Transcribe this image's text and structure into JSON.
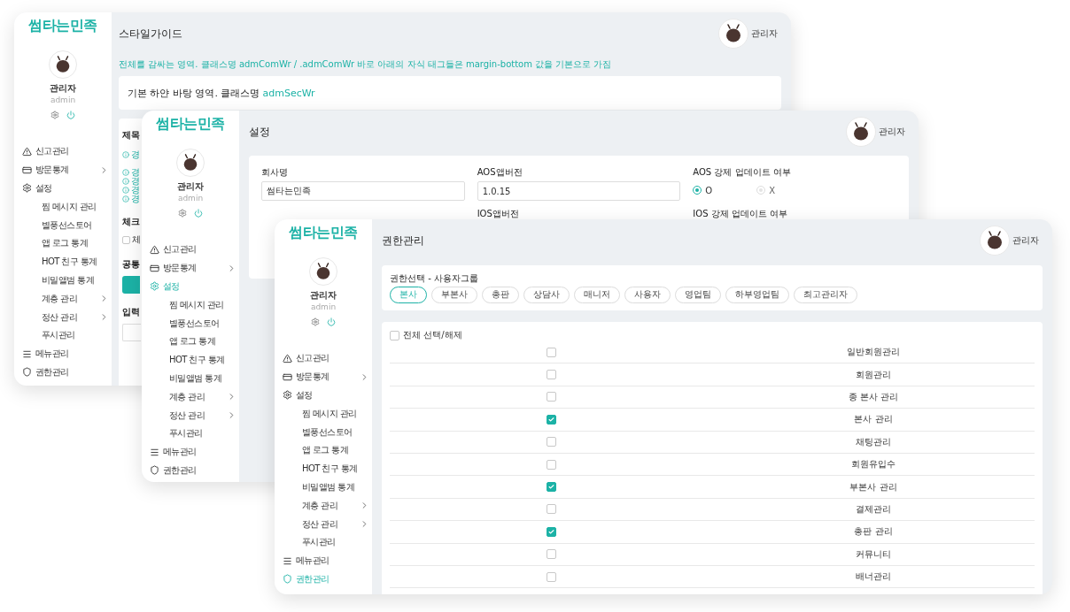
{
  "windows": [
    {
      "kind": "styleguide",
      "sidebar": {
        "logo": "썸타는민족",
        "profile": {
          "name": "관리자",
          "role": "admin"
        },
        "menu": [
          {
            "label": "신고관리",
            "kind": "main",
            "has_submenu": false,
            "selected": false
          },
          {
            "label": "방문통계",
            "kind": "main",
            "has_submenu": true,
            "selected": false
          },
          {
            "label": "설정",
            "kind": "main",
            "has_submenu": false,
            "selected": false
          },
          {
            "label": "찜 메시지 관리",
            "kind": "sub",
            "has_submenu": false,
            "selected": false
          },
          {
            "label": "별풍선스토어",
            "kind": "sub",
            "has_submenu": false,
            "selected": false
          },
          {
            "label": "앱 로그 통계",
            "kind": "sub",
            "has_submenu": false,
            "selected": false
          },
          {
            "label": "HOT 친구 통계",
            "kind": "sub",
            "has_submenu": false,
            "selected": false
          },
          {
            "label": "비밀앨범 통계",
            "kind": "sub",
            "has_submenu": false,
            "selected": false
          },
          {
            "label": "계층 관리",
            "kind": "sub",
            "has_submenu": true,
            "selected": false
          },
          {
            "label": "정산 관리",
            "kind": "sub",
            "has_submenu": true,
            "selected": false
          },
          {
            "label": "푸시관리",
            "kind": "sub",
            "has_submenu": false,
            "selected": false
          },
          {
            "label": "메뉴관리",
            "kind": "main",
            "has_submenu": false,
            "selected": false
          },
          {
            "label": "권한관리",
            "kind": "main",
            "has_submenu": false,
            "selected": false
          }
        ]
      },
      "header": {
        "title": "스타일가이드",
        "user": "관리자"
      },
      "note": "전체를 감싸는 영역. 클래스명 admComWr / .admComWr 바로 아래의 자식 태그들은 margin-bottom 값을 기본으로 가짐",
      "white_card": {
        "text": "기본 하얀 바탕 영역. 클래스명",
        "class_name": "admSecWr"
      },
      "sections": [
        {
          "title": "제목",
          "warning_groups": [
            [
              "경"
            ],
            [
              "경",
              "경",
              "경",
              "경"
            ]
          ]
        },
        {
          "title": "체크",
          "checkbox": {
            "label": "체",
            "checked": false
          }
        },
        {
          "title": "공통",
          "button": true
        },
        {
          "title": "입력",
          "input": true
        }
      ]
    },
    {
      "kind": "settings",
      "sidebar": {
        "logo": "썸타는민족",
        "profile": {
          "name": "관리자",
          "role": "admin"
        },
        "menu": [
          {
            "label": "신고관리",
            "kind": "main",
            "has_submenu": false,
            "selected": false
          },
          {
            "label": "방문통계",
            "kind": "main",
            "has_submenu": true,
            "selected": false
          },
          {
            "label": "설정",
            "kind": "main",
            "has_submenu": false,
            "selected": true
          },
          {
            "label": "찜 메시지 관리",
            "kind": "sub",
            "has_submenu": false,
            "selected": false
          },
          {
            "label": "별풍선스토어",
            "kind": "sub",
            "has_submenu": false,
            "selected": false
          },
          {
            "label": "앱 로그 통계",
            "kind": "sub",
            "has_submenu": false,
            "selected": false
          },
          {
            "label": "HOT 친구 통계",
            "kind": "sub",
            "has_submenu": false,
            "selected": false
          },
          {
            "label": "비밀앨범 통계",
            "kind": "sub",
            "has_submenu": false,
            "selected": false
          },
          {
            "label": "계층 관리",
            "kind": "sub",
            "has_submenu": true,
            "selected": false
          },
          {
            "label": "정산 관리",
            "kind": "sub",
            "has_submenu": true,
            "selected": false
          },
          {
            "label": "푸시관리",
            "kind": "sub",
            "has_submenu": false,
            "selected": false
          },
          {
            "label": "메뉴관리",
            "kind": "main",
            "has_submenu": false,
            "selected": false
          },
          {
            "label": "권한관리",
            "kind": "main",
            "has_submenu": false,
            "selected": false
          }
        ]
      },
      "header": {
        "title": "설정",
        "user": "관리자"
      },
      "field_rows": [
        [
          {
            "kind": "input",
            "label": "회사명",
            "value": "썸타는민족"
          },
          {
            "kind": "input",
            "label": "AOS앱버전",
            "value": "1.0.15"
          },
          {
            "kind": "radio",
            "label": "AOS 강제 업데이트 여부",
            "options": [
              {
                "label": "O",
                "selected": true
              },
              {
                "label": "X",
                "selected": false
              }
            ]
          }
        ],
        [
          {
            "kind": "label",
            "label": "IOS앱버전"
          },
          {
            "kind": "label",
            "label": "IOS 강제 업데이트 여부"
          }
        ]
      ]
    },
    {
      "kind": "permissions",
      "sidebar": {
        "logo": "썸타는민족",
        "profile": {
          "name": "관리자",
          "role": "admin"
        },
        "menu": [
          {
            "label": "신고관리",
            "kind": "main",
            "has_submenu": false,
            "selected": false
          },
          {
            "label": "방문통계",
            "kind": "main",
            "has_submenu": true,
            "selected": false
          },
          {
            "label": "설정",
            "kind": "main",
            "has_submenu": false,
            "selected": false
          },
          {
            "label": "찜 메시지 관리",
            "kind": "sub",
            "has_submenu": false,
            "selected": false
          },
          {
            "label": "별풍선스토어",
            "kind": "sub",
            "has_submenu": false,
            "selected": false
          },
          {
            "label": "앱 로그 통계",
            "kind": "sub",
            "has_submenu": false,
            "selected": false
          },
          {
            "label": "HOT 친구 통계",
            "kind": "sub",
            "has_submenu": false,
            "selected": false
          },
          {
            "label": "비밀앨범 통계",
            "kind": "sub",
            "has_submenu": false,
            "selected": false
          },
          {
            "label": "계층 관리",
            "kind": "sub",
            "has_submenu": true,
            "selected": false
          },
          {
            "label": "정산 관리",
            "kind": "sub",
            "has_submenu": true,
            "selected": false
          },
          {
            "label": "푸시관리",
            "kind": "sub",
            "has_submenu": false,
            "selected": false
          },
          {
            "label": "메뉴관리",
            "kind": "main",
            "has_submenu": false,
            "selected": false
          },
          {
            "label": "권한관리",
            "kind": "main",
            "has_submenu": false,
            "selected": true
          }
        ]
      },
      "header": {
        "title": "권한관리",
        "user": "관리자"
      },
      "group_label": "권한선택 - 사용자그룹",
      "groups": [
        {
          "label": "본사",
          "selected": true
        },
        {
          "label": "부본사",
          "selected": false
        },
        {
          "label": "총판",
          "selected": false
        },
        {
          "label": "상담사",
          "selected": false
        },
        {
          "label": "매니저",
          "selected": false
        },
        {
          "label": "사용자",
          "selected": false
        },
        {
          "label": "영업팀",
          "selected": false
        },
        {
          "label": "하부영업팀",
          "selected": false
        },
        {
          "label": "최고관리자",
          "selected": false
        }
      ],
      "select_all": {
        "label": "전체 선택/해제",
        "checked": false
      },
      "permissions": [
        {
          "name": "일반회원관리",
          "checked": false
        },
        {
          "name": "회원관리",
          "checked": false
        },
        {
          "name": "종 본사 관리",
          "checked": false
        },
        {
          "name": "본사 관리",
          "checked": true
        },
        {
          "name": "채팅관리",
          "checked": false
        },
        {
          "name": "회원유입수",
          "checked": false
        },
        {
          "name": "부본사 관리",
          "checked": true
        },
        {
          "name": "결제관리",
          "checked": false
        },
        {
          "name": "총판 관리",
          "checked": true
        },
        {
          "name": "커뮤니티",
          "checked": false
        },
        {
          "name": "배너관리",
          "checked": false
        }
      ]
    }
  ]
}
